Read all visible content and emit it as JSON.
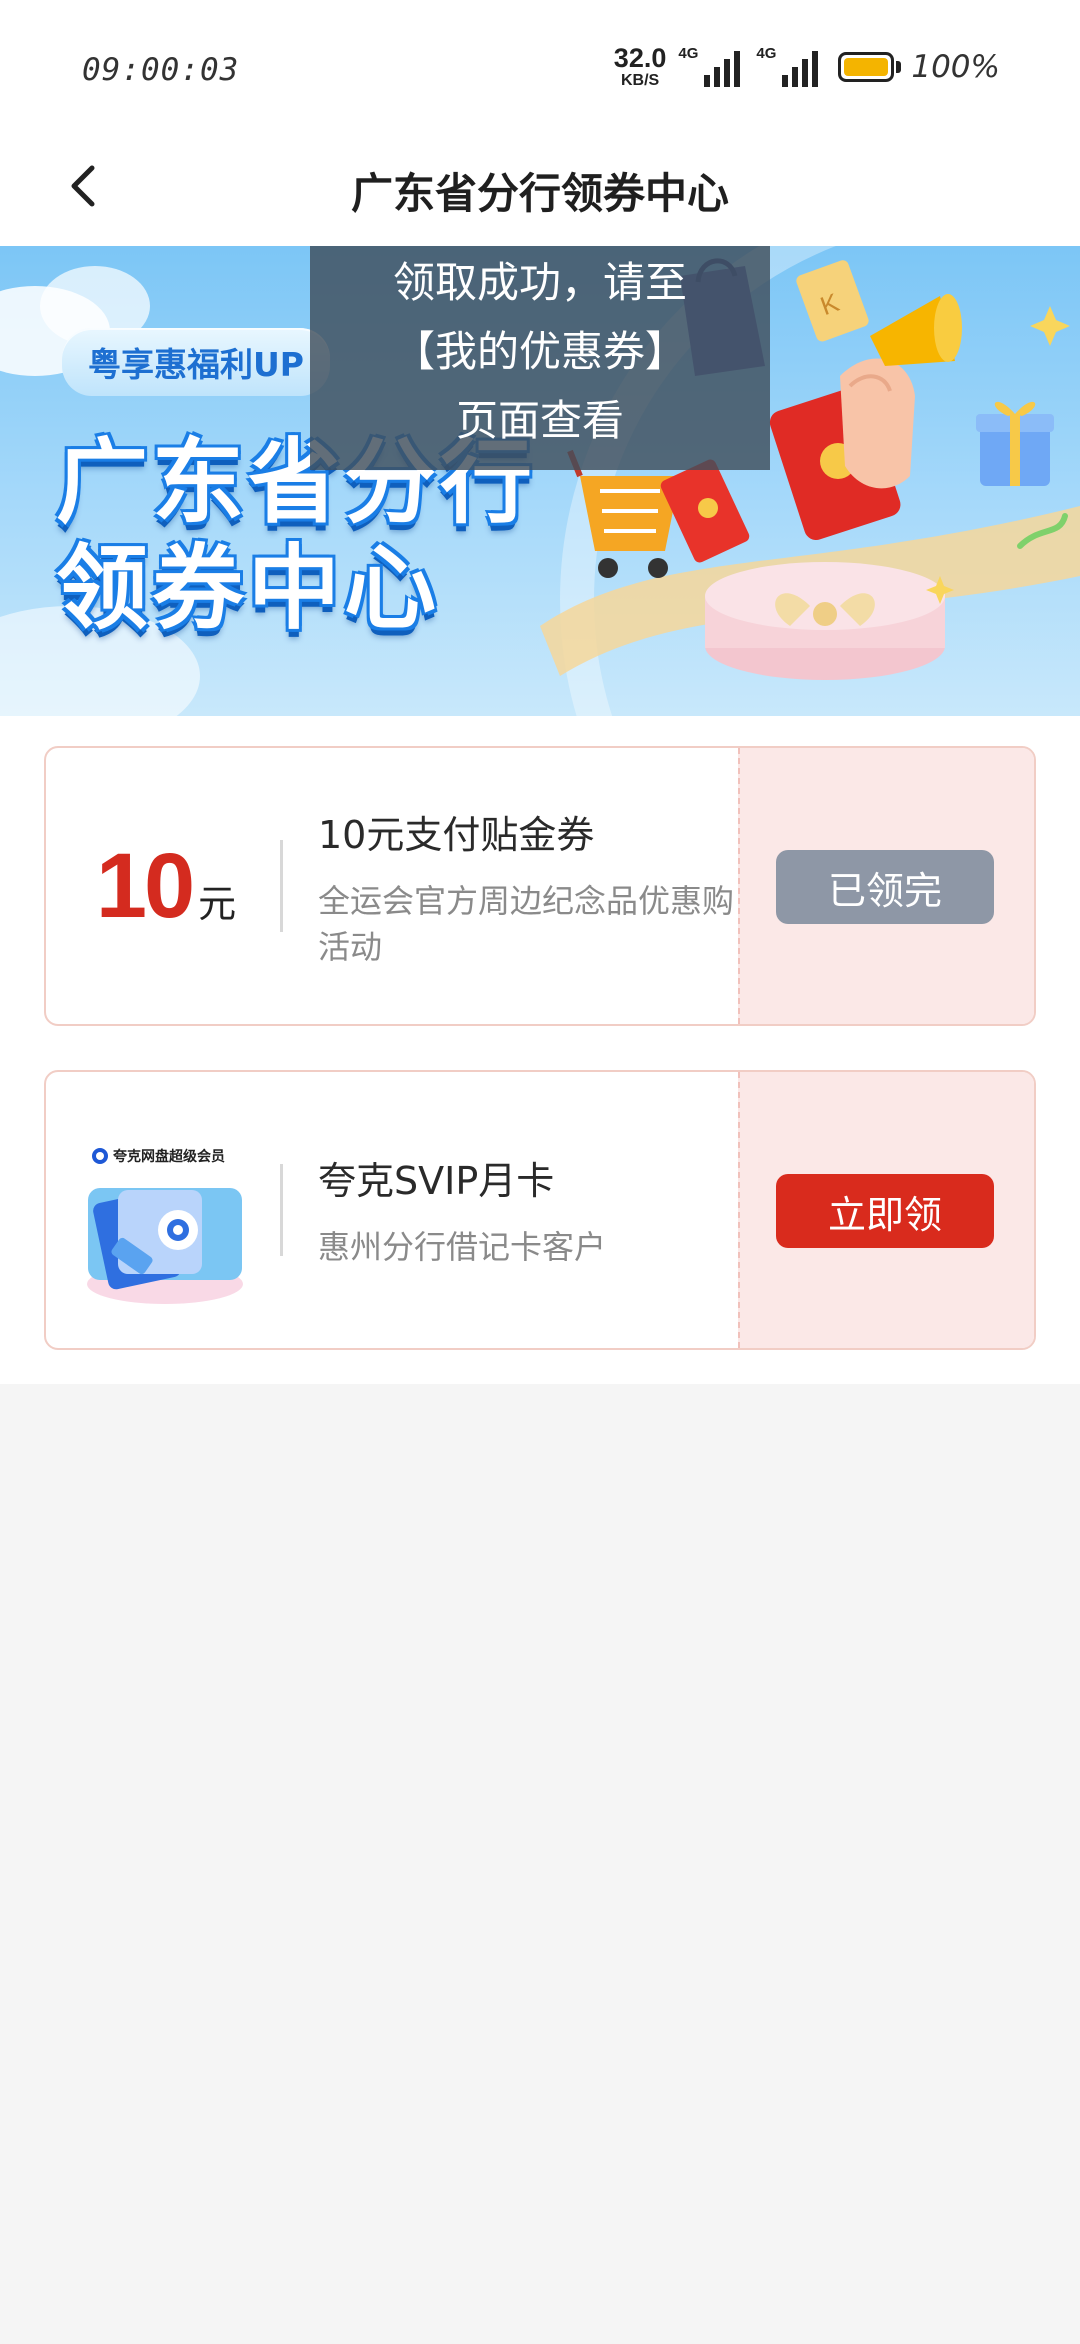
{
  "status_bar": {
    "time": "09:00:03",
    "net_speed_value": "32.0",
    "net_speed_unit": "KB/S",
    "signal_1_label": "4G",
    "signal_2_label": "4G",
    "battery_percent": "100%",
    "battery_color": "#f4b400"
  },
  "nav": {
    "title": "广东省分行领券中心",
    "back_icon": "chevron-left-icon"
  },
  "banner": {
    "tag": "粤享惠福利UP",
    "title_line1": "广东省分行",
    "title_line2": "领券中心"
  },
  "toast": {
    "line1": "领取成功，请至",
    "line2": "【我的优惠券】",
    "line3": "页面查看"
  },
  "coupons": [
    {
      "amount": "10",
      "unit": "元",
      "title": "10元支付贴金券",
      "desc": "全运会官方周边纪念品优惠购活动",
      "button": "已领完",
      "state": "claimed"
    },
    {
      "image_label": "夸克网盘超级会员",
      "title": "夸克SVIP月卡",
      "desc": "惠州分行借记卡客户",
      "button": "立即领",
      "state": "available"
    }
  ],
  "colors": {
    "accent_red": "#d92b1d",
    "disabled_gray": "#8e97a6",
    "coupon_right_bg": "#fbe8e7"
  }
}
